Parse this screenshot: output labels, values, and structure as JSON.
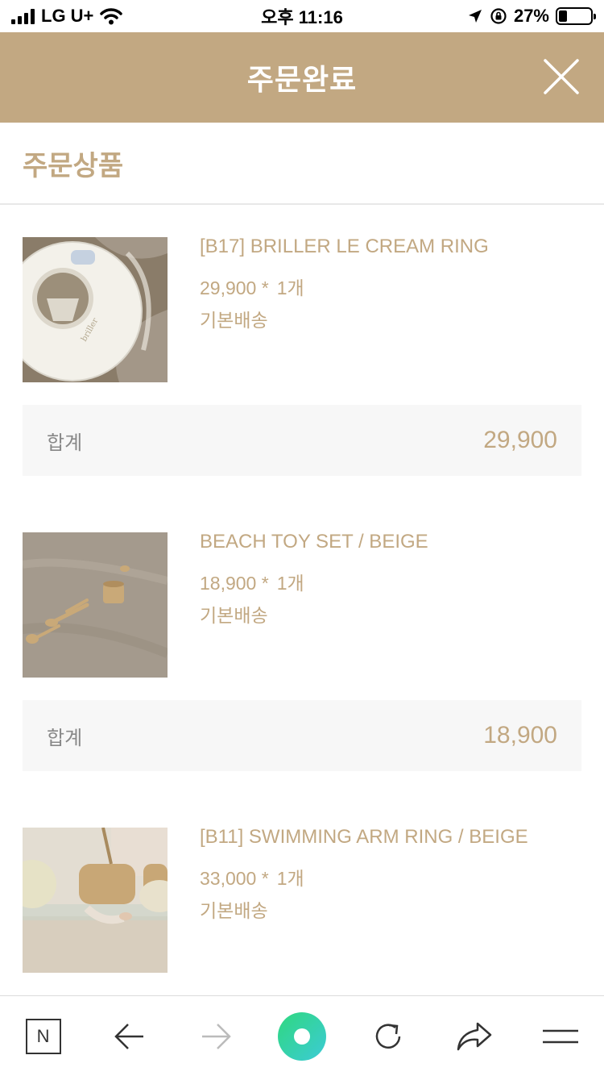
{
  "status_bar": {
    "carrier": "LG U+",
    "time": "오후 11:16",
    "battery": "27%",
    "battery_level": 0.27
  },
  "header": {
    "title": "주문완료",
    "close_icon": "close-icon"
  },
  "section": {
    "title": "주문상품"
  },
  "orders": [
    {
      "name": "[B17] BRILLER LE CREAM RING",
      "price": "29,900 *",
      "quantity": "1개",
      "shipping": "기본배송",
      "total_label": "합계",
      "total": "29,900"
    },
    {
      "name": "BEACH TOY SET / BEIGE",
      "price": "18,900 *",
      "quantity": "1개",
      "shipping": "기본배송",
      "total_label": "합계",
      "total": "18,900"
    },
    {
      "name": "[B11] SWIMMING ARM RING / BEIGE",
      "price": "33,000 *",
      "quantity": "1개",
      "shipping": "기본배송"
    }
  ],
  "toolbar": {
    "home_label": "N",
    "icons": [
      "naver-home-icon",
      "back-arrow-icon",
      "forward-arrow-icon",
      "green-dot-icon",
      "refresh-icon",
      "share-icon",
      "menu-icon"
    ]
  },
  "colors": {
    "accent": "#c2a882",
    "total_bg": "#f7f7f7",
    "label_gray": "#888888"
  }
}
